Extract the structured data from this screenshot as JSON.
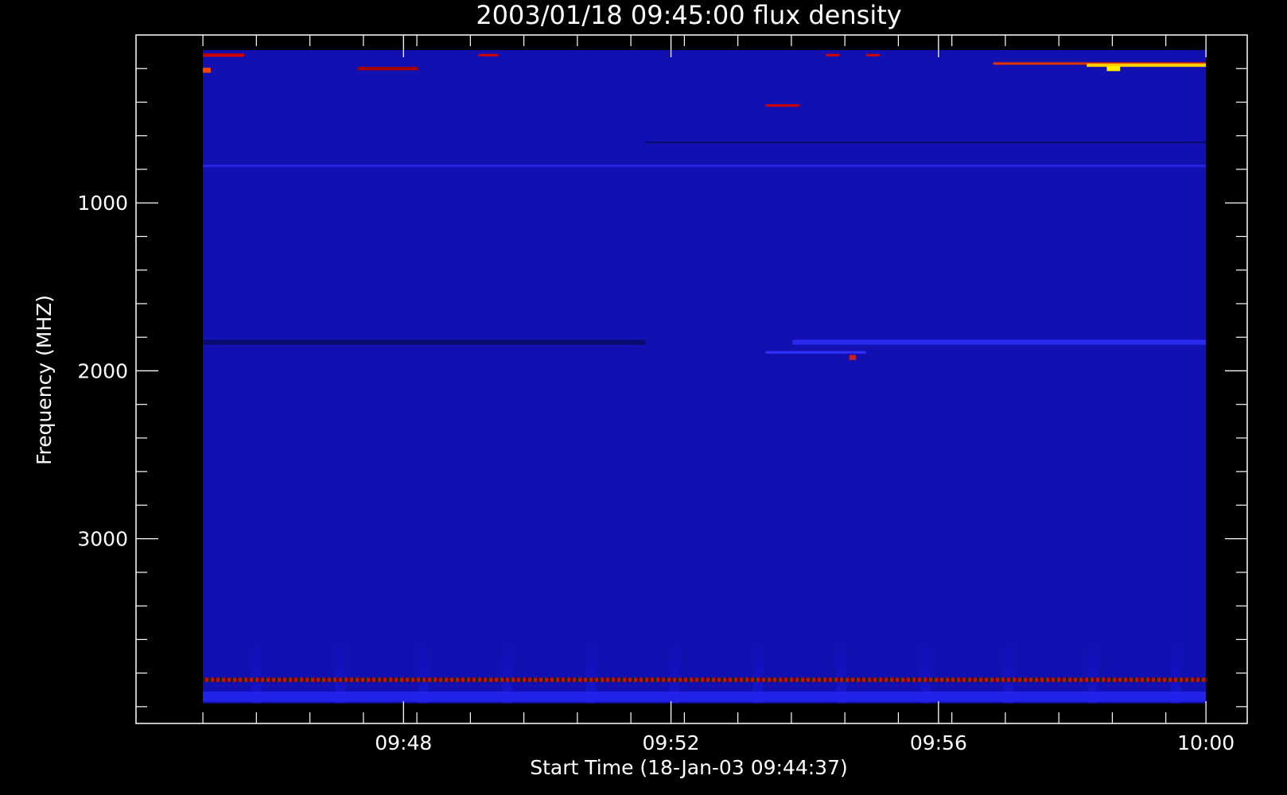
{
  "chart_data": {
    "type": "heatmap",
    "title": "2003/01/18 09:45:00 flux density",
    "xlabel": "Start Time (18-Jan-03 09:44:37)",
    "ylabel": "Frequency (MHZ)",
    "x_ticks": [
      "09:48",
      "09:52",
      "09:56",
      "10:00"
    ],
    "x_tick_minutes": [
      3.383,
      7.383,
      11.383,
      15.383
    ],
    "x_minor_step_minutes": 0.8,
    "data_x_start_minutes": 0.383,
    "data_x_end_minutes": 15.383,
    "xlim_minutes": [
      -0.617,
      16.0
    ],
    "y_ticks": [
      "1000",
      "2000",
      "3000"
    ],
    "y_tick_values": [
      1000,
      2000,
      3000
    ],
    "y_minor_step": 200,
    "ylim": [
      4100,
      0
    ],
    "data_y_range": [
      90,
      3980
    ],
    "y_reversed": true,
    "colormap": [
      "#000000",
      "#0a0a8c",
      "#1a1ad8",
      "#cc0000",
      "#ff5500",
      "#ffee00"
    ],
    "background_color": "#1210b0",
    "features": [
      {
        "kind": "band",
        "freq": 780,
        "width": 15,
        "x_from": 0.383,
        "x_to": 15.383,
        "color": "#2424e0"
      },
      {
        "kind": "band",
        "freq": 1830,
        "width": 30,
        "x_from": 0.383,
        "x_to": 7.0,
        "color": "#0a0a70"
      },
      {
        "kind": "band",
        "freq": 1830,
        "width": 30,
        "x_from": 9.2,
        "x_to": 15.383,
        "color": "#2a2aee"
      },
      {
        "kind": "band",
        "freq": 1890,
        "width": 15,
        "x_from": 8.8,
        "x_to": 10.3,
        "color": "#3030ff"
      },
      {
        "kind": "band",
        "freq": 640,
        "width": 8,
        "x_from": 7.0,
        "x_to": 15.383,
        "color": "#080860"
      },
      {
        "kind": "band",
        "freq": 3840,
        "width": 25,
        "x_from": 0.383,
        "x_to": 15.383,
        "color": "#cc1010"
      },
      {
        "kind": "band",
        "freq": 170,
        "width": 15,
        "x_from": 12.2,
        "x_to": 15.383,
        "color": "#dd3300"
      },
      {
        "kind": "band",
        "freq": 120,
        "width": 20,
        "x_from": 0.383,
        "x_to": 1.0,
        "color": "#cc0000"
      },
      {
        "kind": "band",
        "freq": 210,
        "width": 30,
        "x_from": 0.383,
        "x_to": 0.5,
        "color": "#ff4400"
      },
      {
        "kind": "band",
        "freq": 120,
        "width": 15,
        "x_from": 4.5,
        "x_to": 4.8,
        "color": "#cc0000"
      },
      {
        "kind": "band",
        "freq": 120,
        "width": 15,
        "x_from": 9.7,
        "x_to": 9.9,
        "color": "#cc0000"
      },
      {
        "kind": "band",
        "freq": 120,
        "width": 15,
        "x_from": 10.3,
        "x_to": 10.5,
        "color": "#cc0000"
      },
      {
        "kind": "band",
        "freq": 420,
        "width": 15,
        "x_from": 8.8,
        "x_to": 9.3,
        "color": "#cc0000"
      },
      {
        "kind": "band",
        "freq": 200,
        "width": 20,
        "x_from": 2.7,
        "x_to": 3.6,
        "color": "#aa0000"
      },
      {
        "kind": "band",
        "freq": 1920,
        "width": 30,
        "x_from": 10.05,
        "x_to": 10.15,
        "color": "#cc2020"
      },
      {
        "kind": "band",
        "freq": 180,
        "width": 20,
        "x_from": 13.6,
        "x_to": 15.383,
        "color": "#ffcc00"
      },
      {
        "kind": "band",
        "freq": 200,
        "width": 30,
        "x_from": 13.9,
        "x_to": 14.1,
        "color": "#ffee00"
      },
      {
        "kind": "band",
        "freq": 3940,
        "width": 60,
        "x_from": 0.383,
        "x_to": 15.383,
        "color": "#2222e8"
      }
    ]
  }
}
